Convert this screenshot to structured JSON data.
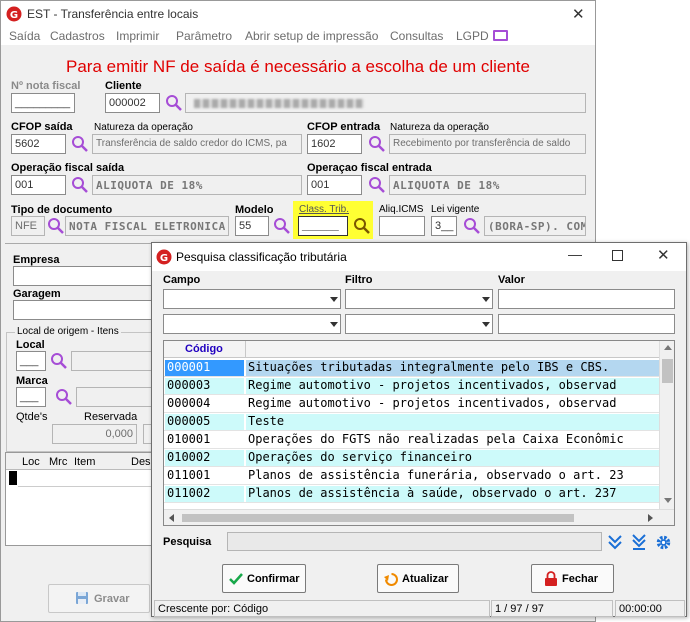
{
  "main_window": {
    "title": "EST - Transferência entre locais",
    "menu": [
      "Saída",
      "Cadastros",
      "Imprimir",
      "Parâmetro",
      "Abrir setup de impressão",
      "Consultas",
      "LGPD"
    ],
    "warning": "Para emitir NF de saída é necessário a escolha de um cliente",
    "nf_label": "Nº nota fiscal",
    "nf_value": "_________",
    "cliente_label": "Cliente",
    "cliente_code": "000002",
    "cfop_saida_label": "CFOP saída",
    "cfop_saida_value": "5602",
    "natureza_label": "Natureza da operação",
    "natureza_saida": "Transferência de saldo credor do ICMS, pa",
    "cfop_entrada_label": "CFOP entrada",
    "natureza_entrada_label": "Natureza da operação",
    "cfop_entrada_value": "1602",
    "natureza_entrada": "Recebimento por transferência de saldo",
    "op_saida_label": "Operação fiscal saída",
    "op_saida_code": "001",
    "op_saida_desc": "ALIQUOTA DE 18%",
    "op_entrada_label": "Operaçao fiscal entrada",
    "op_entrada_code": "001",
    "op_entrada_desc": "ALIQUOTA DE 18%",
    "tipo_doc_label": "Tipo de documento",
    "tipo_doc_code": "NFE",
    "tipo_doc_desc": "NOTA FISCAL ELETRONICA",
    "modelo_label": "Modelo",
    "modelo_value": "55",
    "class_trib_label": "Class. Trib.",
    "class_trib_value": "______",
    "aliq_label": "Aliq.ICMS",
    "lei_label": "Lei vigente",
    "lei_code": "3__",
    "lei_desc": "(BORA-SP). COM",
    "empresa_label": "Empresa",
    "garagem_label": "Garagem",
    "origem_group_label": "Local de origem - Itens",
    "local_label": "Local",
    "local_value": "___",
    "marca_label": "Marca",
    "marca_value": "___",
    "qtdes_label": "Qtde's",
    "reservada_label": "Reservada",
    "reservada_value": "0,000",
    "items_cols": [
      "Loc",
      "Mrc",
      "Item",
      "Des"
    ],
    "gravar_label": "Gravar"
  },
  "dialog": {
    "title": "Pesquisa classificação tributária",
    "campo_label": "Campo",
    "filtro_label": "Filtro",
    "valor_label": "Valor",
    "grid_header": "Código",
    "rows": [
      {
        "code": "000001",
        "desc": "Situações tributadas integralmente pelo IBS e CBS."
      },
      {
        "code": "000003",
        "desc": "Regime automotivo - projetos incentivados, observad"
      },
      {
        "code": "000004",
        "desc": "Regime automotivo - projetos incentivados, observad"
      },
      {
        "code": "000005",
        "desc": "Teste"
      },
      {
        "code": "010001",
        "desc": "Operações do FGTS não realizadas pela Caixa Econômic"
      },
      {
        "code": "010002",
        "desc": "Operações do serviço financeiro"
      },
      {
        "code": "011001",
        "desc": "Planos de assistência funerária, observado o art. 23"
      },
      {
        "code": "011002",
        "desc": "Planos de assistência à saúde, observado o art. 237"
      }
    ],
    "pesquisa_label": "Pesquisa",
    "buttons": {
      "confirmar": "Confirmar",
      "atualizar": "Atualizar",
      "fechar": "Fechar"
    },
    "status_order": "Crescente por: Código",
    "status_count": "1 / 97 / 97",
    "status_time": "00:00:00"
  },
  "colors": {
    "accent_purple": "#a64dd6",
    "warning_red": "#e00000",
    "row_cyan": "#cdfafa",
    "row_selected": "#3399ff",
    "highlight_yellow": "#ffff33"
  }
}
